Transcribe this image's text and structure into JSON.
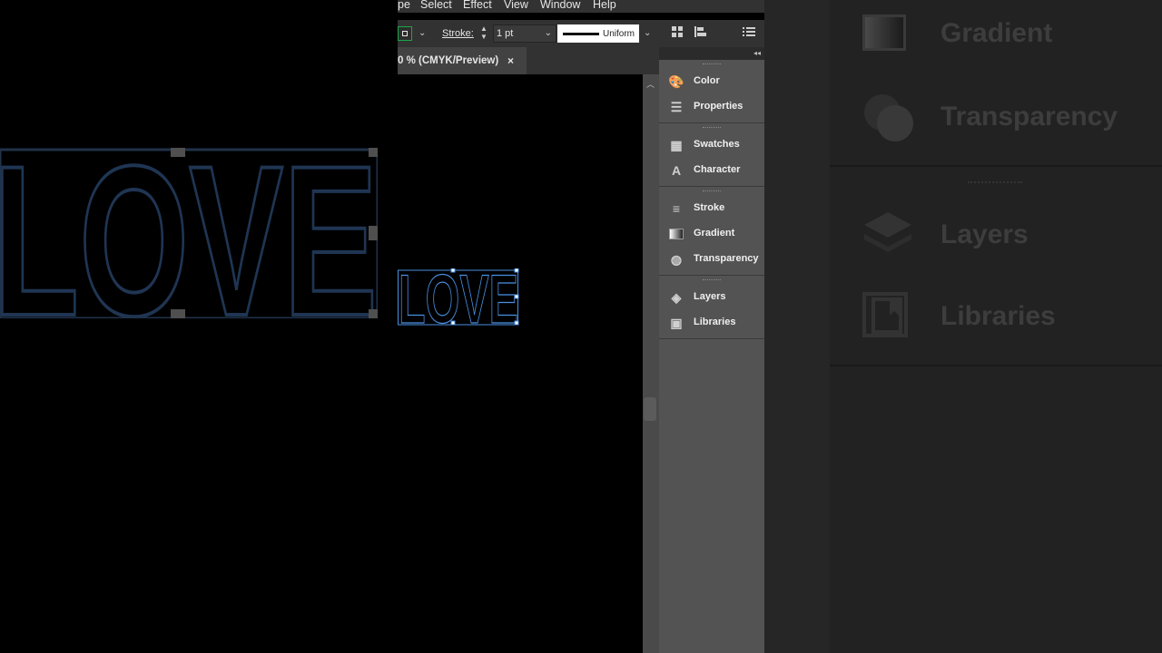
{
  "menu": [
    "pe",
    "Select",
    "Effect",
    "View",
    "Window",
    "Help"
  ],
  "control": {
    "stroke_label": "Stroke:",
    "stroke_value": "1 pt",
    "profile_label": "Uniform"
  },
  "tab": {
    "title": "0 % (CMYK/Preview)",
    "close": "×"
  },
  "artwork": {
    "text": "LOVE"
  },
  "panels": {
    "groups": [
      {
        "items": [
          {
            "label": "Color",
            "icon": "color-palette-icon"
          },
          {
            "label": "Properties",
            "icon": "sliders-icon"
          }
        ]
      },
      {
        "items": [
          {
            "label": "Swatches",
            "icon": "swatches-grid-icon"
          },
          {
            "label": "Character",
            "icon": "character-type-icon"
          }
        ]
      },
      {
        "items": [
          {
            "label": "Stroke",
            "icon": "stroke-lines-icon"
          },
          {
            "label": "Gradient",
            "icon": "gradient-icon"
          },
          {
            "label": "Transparency",
            "icon": "transparency-circles-icon"
          }
        ]
      },
      {
        "items": [
          {
            "label": "Layers",
            "icon": "layers-stack-icon"
          },
          {
            "label": "Libraries",
            "icon": "libraries-book-icon"
          }
        ]
      }
    ]
  },
  "zoom": {
    "items": [
      {
        "label": "Gradient"
      },
      {
        "label": "Transparency"
      },
      {
        "label": "Layers"
      },
      {
        "label": "Libraries"
      }
    ]
  },
  "colors": {
    "selection": "#4a90e2",
    "chrome": "#323232",
    "panel": "#535353",
    "canvas": "#000000"
  }
}
